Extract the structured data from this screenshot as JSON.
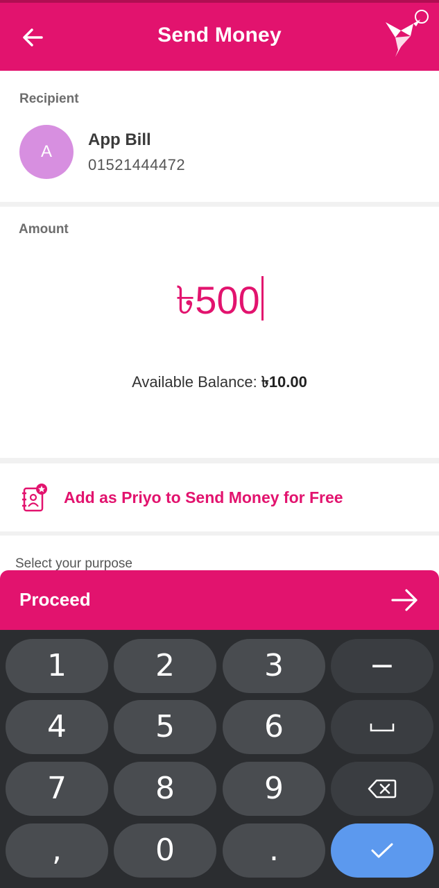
{
  "header": {
    "title": "Send Money"
  },
  "recipient": {
    "section_label": "Recipient",
    "avatar_initial": "A",
    "name": "App Bill",
    "phone": "01521444472"
  },
  "amount": {
    "section_label": "Amount",
    "value": "৳500",
    "balance_label": "Available Balance: ",
    "balance_value": "৳10.00"
  },
  "priyo": {
    "label": "Add as Priyo to Send Money for Free"
  },
  "purpose": {
    "label": "Select your purpose"
  },
  "proceed": {
    "label": "Proceed"
  },
  "keyboard": {
    "keys": [
      "1",
      "2",
      "3",
      "−",
      "4",
      "5",
      "6",
      "␣",
      "7",
      "8",
      "9",
      "⌫",
      ",",
      "0",
      ".",
      "✓"
    ]
  },
  "colors": {
    "brand": "#e2136e",
    "avatar": "#d78fe0",
    "keyboard_bg": "#2b2d30",
    "key": "#494c50",
    "enter_key": "#5c99ee"
  }
}
